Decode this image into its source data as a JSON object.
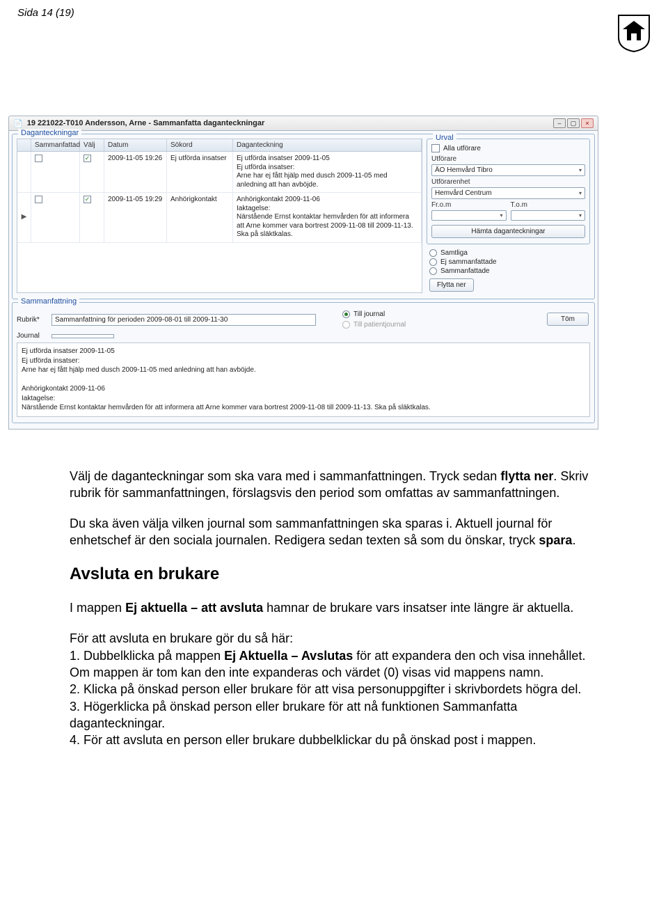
{
  "header": {
    "page_number": "Sida 14 (19)"
  },
  "window": {
    "title": "19 221022-T010   Andersson, Arne   -   Sammanfatta daganteckningar",
    "group_daganteckningar": "Daganteckningar",
    "columns": {
      "sammanfattad": "Sammanfattad",
      "valj": "Välj",
      "datum": "Datum",
      "sokord": "Sökord",
      "daganteckning": "Daganteckning"
    },
    "rows": [
      {
        "sammanfattad": false,
        "valj": true,
        "datum": "2009-11-05 19:26",
        "sokord": "Ej utförda insatser",
        "text": "Ej utförda insatser 2009-11-05\nEj utförda insatser:\nArne har ej fått hjälp med dusch 2009-11-05 med anledning att han avböjde."
      },
      {
        "marker": "▶",
        "sammanfattad": false,
        "valj": true,
        "datum": "2009-11-05 19:29",
        "sokord": "Anhörigkontakt",
        "text": "Anhörigkontakt 2009-11-06\nIaktagelse:\nNärstående Ernst kontaktar hemvården för att informera att Arne kommer vara bortrest 2009-11-08 till 2009-11-13. Ska på släktkalas."
      }
    ],
    "urval": {
      "title": "Urval",
      "alla_utforare": "Alla utförare",
      "utforare_label": "Utförare",
      "utforare_value": "ÄO Hemvård Tibro",
      "utforarenhet_label": "Utförarenhet",
      "utforarenhet_value": "Hemvård Centrum",
      "from_label": "Fr.o.m",
      "tom_label": "T.o.m",
      "hamta_btn": "Hämta daganteckningar",
      "samtliga": "Samtliga",
      "ej_sammanfattade": "Ej sammanfattade",
      "sammanfattade": "Sammanfattade",
      "flytta_ner": "Flytta ner"
    },
    "sammanfattning": {
      "title": "Sammanfattning",
      "rubrik_label": "Rubrik*",
      "rubrik_value": "Sammanfattning för perioden 2009-08-01 till 2009-11-30",
      "journal_label": "Journal",
      "journal_value": "",
      "till_journal": "Till journal",
      "till_patientjournal": "Till patientjournal",
      "tom_btn": "Töm",
      "text": "Ej utförda insatser 2009-11-05\nEj utförda insatser:\nArne har ej fått hjälp med dusch 2009-11-05 med anledning att han avböjde.\n\nAnhörigkontakt 2009-11-06\nIaktagelse:\nNärstående Ernst kontaktar hemvården för att informera att Arne kommer vara bortrest 2009-11-08 till 2009-11-13. Ska på släktkalas."
    }
  },
  "doc": {
    "p1a": "Välj de daganteckningar som ska vara med i sammanfattningen. Tryck sedan ",
    "p1b": "flytta ner",
    "p1c": ". Skriv rubrik för sammanfattningen, förslagsvis den period som omfattas av sammanfattningen.",
    "p2a": "Du ska även välja vilken journal som sammanfattningen ska sparas i. Aktuell journal för enhetschef är den sociala journalen. Redigera sedan texten så som du önskar, tryck ",
    "p2b": "spara",
    "p2c": ".",
    "h2": "Avsluta en brukare",
    "p3a": "I mappen ",
    "p3b": "Ej aktuella – att avsluta",
    "p3c": " hamnar de brukare vars insatser inte längre är aktuella.",
    "p4": "För att avsluta en brukare gör du så här:",
    "li1a": "1. Dubbelklicka på mappen ",
    "li1b": "Ej Aktuella – Avslutas",
    "li1c": " för att expandera den och visa innehållet. Om mappen är tom kan den inte expanderas och värdet (0) visas vid mappens namn.",
    "li2": "2. Klicka på önskad person eller brukare för att visa personuppgifter i skrivbordets högra del.",
    "li3": "3. Högerklicka på önskad person eller brukare för att nå funktionen Sammanfatta daganteckningar.",
    "li4": "4. För att avsluta en person eller brukare dubbelklickar du på önskad post i mappen."
  }
}
